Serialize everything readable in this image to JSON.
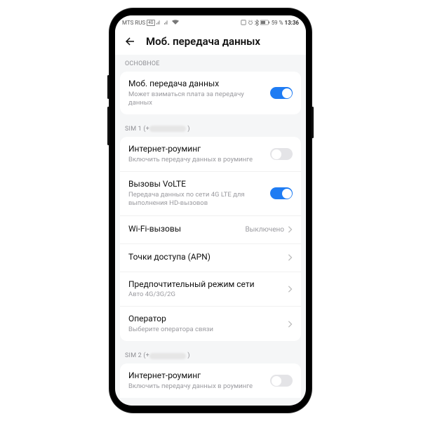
{
  "status": {
    "carrier": "MTS RUS",
    "net_badge": "4G",
    "battery_text": "59 %",
    "time": "13:36"
  },
  "header": {
    "title": "Моб. передача данных"
  },
  "group_basic": "ОСНОВНОЕ",
  "mobile_data": {
    "title": "Моб. передача данных",
    "sub": "Может взиматься плата за передачу данных",
    "on": true
  },
  "sim1_label": "SIM 1 (+",
  "roaming": {
    "title": "Интернет-роуминг",
    "sub": "Включить передачу данных в роуминге",
    "on": false
  },
  "volte": {
    "title": "Вызовы VoLTE",
    "sub": "Передача данных по сети 4G LTE для выполнения HD-вызовов",
    "on": true
  },
  "wifi_calling": {
    "title": "Wi-Fi-вызовы",
    "value": "Выключено"
  },
  "apn": {
    "title": "Точки доступа (APN)"
  },
  "net_mode": {
    "title": "Предпочтительный режим сети",
    "sub": "Авто 4G/3G/2G"
  },
  "operator": {
    "title": "Оператор",
    "sub": "Выберите оператора связи"
  },
  "sim2_label": "SIM 2 (+",
  "roaming2": {
    "title": "Интернет-роуминг",
    "sub": "Включить передачу данных в роуминге",
    "on": false
  },
  "colors": {
    "accent": "#1f7cf3"
  }
}
